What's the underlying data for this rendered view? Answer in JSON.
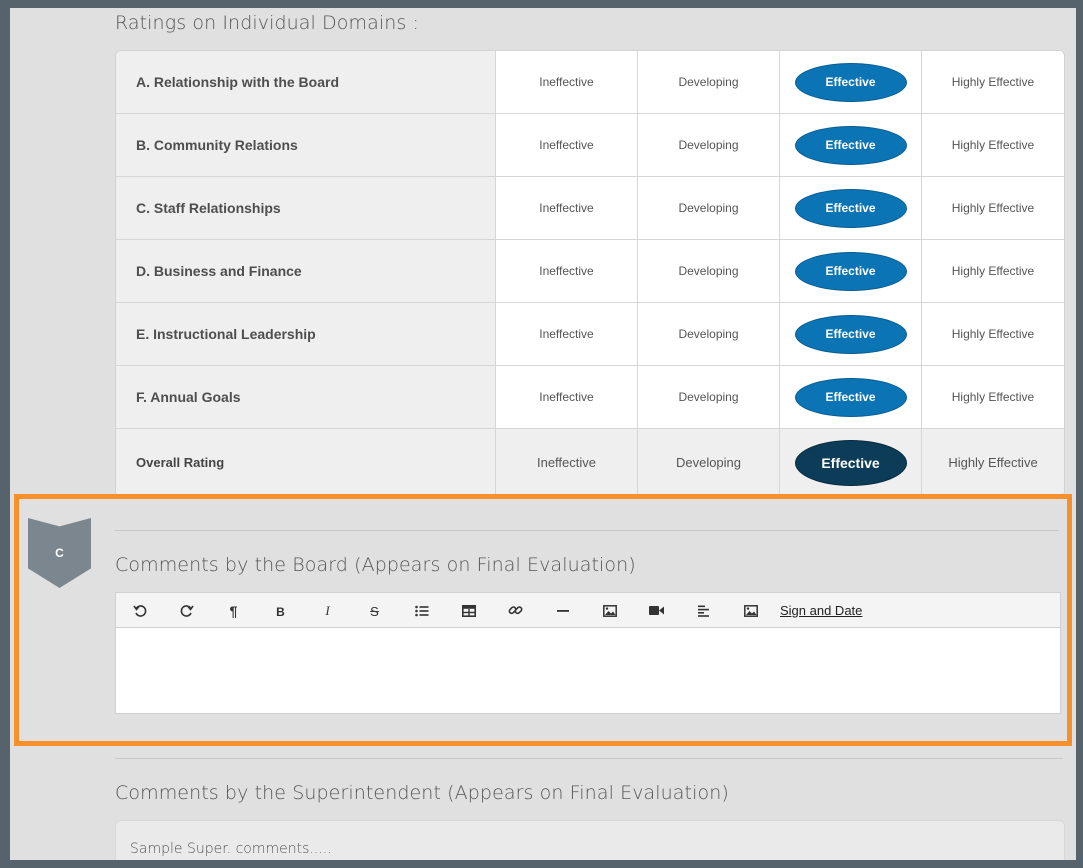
{
  "ratings": {
    "title": "Ratings on Individual Domains :",
    "levels": [
      "Ineffective",
      "Developing",
      "Effective",
      "Highly Effective"
    ],
    "rows": [
      {
        "label": "A. Relationship with the Board",
        "selected": "Effective"
      },
      {
        "label": "B. Community Relations",
        "selected": "Effective"
      },
      {
        "label": "C. Staff Relationships",
        "selected": "Effective"
      },
      {
        "label": "D. Business and Finance",
        "selected": "Effective"
      },
      {
        "label": "E. Instructional Leadership",
        "selected": "Effective"
      },
      {
        "label": "F. Annual Goals",
        "selected": "Effective"
      }
    ],
    "overall": {
      "label": "Overall Rating",
      "selected": "Effective"
    }
  },
  "section_badge": {
    "letter": "C"
  },
  "board_comments": {
    "title": "Comments by the Board (Appears on Final Evaluation)",
    "toolbar": {
      "buttons": [
        {
          "name": "undo-icon",
          "title": "Undo"
        },
        {
          "name": "redo-icon",
          "title": "Redo"
        },
        {
          "name": "paragraph-icon",
          "title": "Paragraph"
        },
        {
          "name": "bold-icon",
          "title": "Bold"
        },
        {
          "name": "italic-icon",
          "title": "Italic"
        },
        {
          "name": "strikethrough-icon",
          "title": "Strikethrough"
        },
        {
          "name": "bullet-list-icon",
          "title": "List"
        },
        {
          "name": "table-icon",
          "title": "Table"
        },
        {
          "name": "link-icon",
          "title": "Link"
        },
        {
          "name": "horizontal-rule-icon",
          "title": "Line"
        },
        {
          "name": "image-icon",
          "title": "Image"
        },
        {
          "name": "video-icon",
          "title": "Video"
        },
        {
          "name": "align-icon",
          "title": "Align"
        },
        {
          "name": "image-icon",
          "title": "Image"
        }
      ],
      "sign_link": "Sign and Date"
    },
    "value": ""
  },
  "superintendent_comments": {
    "title": "Comments by the Superintendent (Appears on Final Evaluation)",
    "value": "Sample Super. comments....."
  },
  "colors": {
    "accent": "#0a74b5",
    "accent_dark": "#0c3c58",
    "highlight": "#f7902a",
    "frame": "#56636d"
  }
}
